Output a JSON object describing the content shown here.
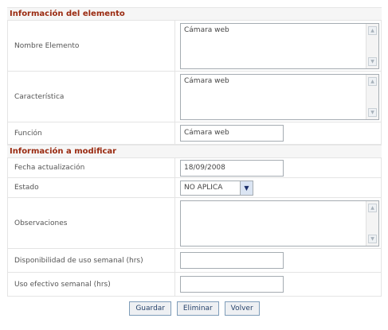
{
  "sections": {
    "info": "Información del elemento",
    "modify": "Información a modificar"
  },
  "fields": {
    "nombre": {
      "label": "Nombre Elemento",
      "value": "Cámara web"
    },
    "caracteristica": {
      "label": "Característica",
      "value": "Cámara web"
    },
    "funcion": {
      "label": "Función",
      "value": "Cámara web"
    },
    "fecha": {
      "label": "Fecha actualización",
      "value": "18/09/2008"
    },
    "estado": {
      "label": "Estado",
      "value": "NO APLICA"
    },
    "observaciones": {
      "label": "Observaciones",
      "value": ""
    },
    "disponibilidad": {
      "label": "Disponibilidad de uso semanal (hrs)",
      "value": ""
    },
    "uso": {
      "label": "Uso efectivo semanal (hrs)",
      "value": ""
    }
  },
  "buttons": {
    "guardar": "Guardar",
    "eliminar": "Eliminar",
    "volver": "Volver"
  }
}
